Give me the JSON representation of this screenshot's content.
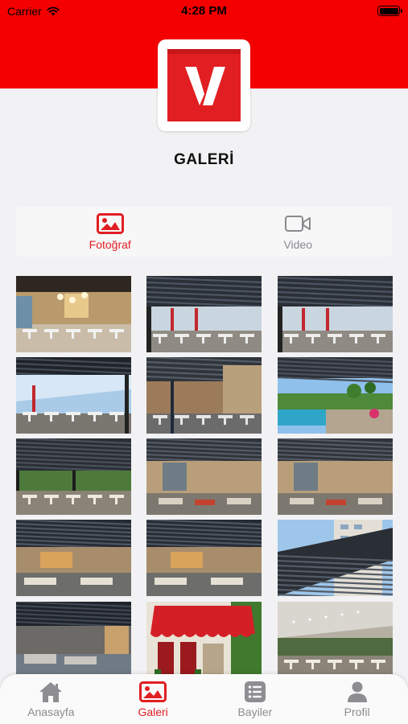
{
  "status_bar": {
    "carrier": "Carrier",
    "time": "4:28 PM"
  },
  "header": {
    "title": "GALERİ",
    "brand_color": "#f50000"
  },
  "tabs": [
    {
      "label": "Fotoğraf",
      "icon": "image-icon",
      "active": true
    },
    {
      "label": "Video",
      "icon": "video-camera-icon",
      "active": false
    }
  ],
  "gallery": {
    "photos": [
      {
        "scene": "indoor-restaurant"
      },
      {
        "scene": "pergola-terrace"
      },
      {
        "scene": "pergola-terrace"
      },
      {
        "scene": "pergola-terrace-sky"
      },
      {
        "scene": "pergola-street"
      },
      {
        "scene": "pergola-pool"
      },
      {
        "scene": "louvre-garden"
      },
      {
        "scene": "louvre-lounge"
      },
      {
        "scene": "louvre-lounge"
      },
      {
        "scene": "louvre-evening"
      },
      {
        "scene": "louvre-evening"
      },
      {
        "scene": "louvre-tower"
      },
      {
        "scene": "louvre-night"
      },
      {
        "scene": "red-awning"
      },
      {
        "scene": "retractable-roof"
      }
    ]
  },
  "bottom_nav": [
    {
      "label": "Anasayfa",
      "icon": "home-icon",
      "active": false
    },
    {
      "label": "Galeri",
      "icon": "gallery-icon",
      "active": true
    },
    {
      "label": "Bayiler",
      "icon": "list-icon",
      "active": false
    },
    {
      "label": "Profil",
      "icon": "person-icon",
      "active": false
    }
  ],
  "colors": {
    "accent": "#e11e22",
    "inactive": "#8d8d92",
    "background": "#f2f2f4"
  }
}
